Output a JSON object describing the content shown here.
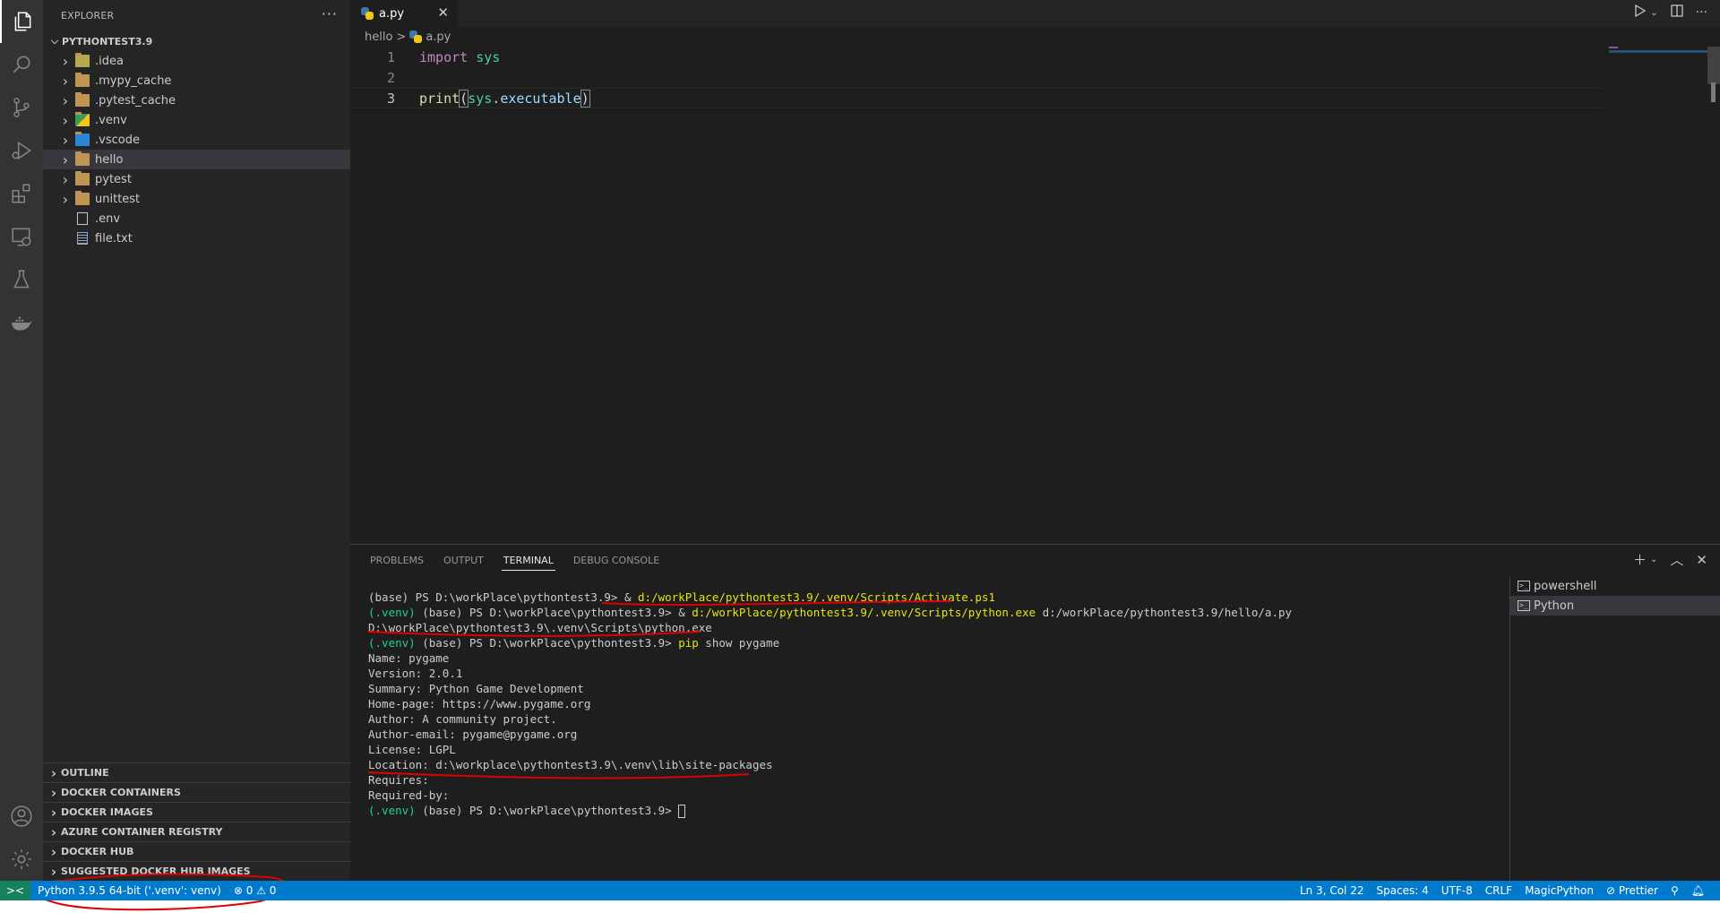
{
  "activity_bar": {
    "items": [
      "explorer",
      "search",
      "source-control",
      "run-and-debug",
      "extensions",
      "remote-explorer",
      "testing",
      "docker"
    ],
    "bottom": [
      "accounts",
      "manage"
    ]
  },
  "sidebar": {
    "title": "EXPLORER",
    "more": "···",
    "root": "PYTHONTEST3.9",
    "items": [
      {
        "label": ".idea",
        "type": "folder-idea"
      },
      {
        "label": ".mypy_cache",
        "type": "folder"
      },
      {
        "label": ".pytest_cache",
        "type": "folder"
      },
      {
        "label": ".venv",
        "type": "folder-python"
      },
      {
        "label": ".vscode",
        "type": "folder-vscode"
      },
      {
        "label": "hello",
        "type": "folder",
        "selected": true
      },
      {
        "label": "pytest",
        "type": "folder"
      },
      {
        "label": "unittest",
        "type": "folder"
      },
      {
        "label": ".env",
        "type": "file"
      },
      {
        "label": "file.txt",
        "type": "text-file"
      }
    ],
    "sections": [
      "OUTLINE",
      "DOCKER CONTAINERS",
      "DOCKER IMAGES",
      "AZURE CONTAINER REGISTRY",
      "DOCKER HUB",
      "SUGGESTED DOCKER HUB IMAGES"
    ]
  },
  "editor": {
    "tab": {
      "label": "a.py",
      "close": "✕"
    },
    "breadcrumb": {
      "folder": "hello",
      "sep": ">",
      "file": "a.py"
    },
    "lines": [
      {
        "n": "1",
        "tokens": [
          [
            "kw",
            "import"
          ],
          [
            "punct",
            " "
          ],
          [
            "mod",
            "sys"
          ]
        ]
      },
      {
        "n": "2",
        "tokens": []
      },
      {
        "n": "3",
        "tokens": [
          [
            "fn",
            "print"
          ],
          [
            "punct-b",
            "("
          ],
          [
            "mod",
            "sys"
          ],
          [
            "punct",
            "."
          ],
          [
            "attr",
            "executable"
          ],
          [
            "punct-b",
            ")"
          ]
        ]
      }
    ],
    "actions": [
      "run-icon",
      "chevron-down-icon",
      "split-editor-icon",
      "more-icon"
    ]
  },
  "panel": {
    "tabs": [
      "PROBLEMS",
      "OUTPUT",
      "TERMINAL",
      "DEBUG CONSOLE"
    ],
    "active_tab": "TERMINAL",
    "terminal_lines": [
      [
        [
          "",
          "(base) PS D:\\workPlace\\pythontest3.9> & "
        ],
        [
          "y",
          "d:/workPlace/pythontest3.9/.venv/Scripts/Activate.ps1"
        ]
      ],
      [
        [
          "g",
          "(.venv) "
        ],
        [
          "",
          "(base) PS D:\\workPlace\\pythontest3.9> & "
        ],
        [
          "y",
          "d:/workPlace/pythontest3.9/.venv/Scripts/python.exe"
        ],
        [
          "",
          " d:/workPlace/pythontest3.9/hello/a.py"
        ]
      ],
      [
        [
          "",
          "D:\\workPlace\\pythontest3.9\\.venv\\Scripts\\python.exe"
        ]
      ],
      [
        [
          "g",
          "(.venv) "
        ],
        [
          "",
          "(base) PS D:\\workPlace\\pythontest3.9> "
        ],
        [
          "y",
          "pip"
        ],
        [
          "",
          " show pygame"
        ]
      ],
      [
        [
          "",
          "Name: pygame"
        ]
      ],
      [
        [
          "",
          "Version: 2.0.1"
        ]
      ],
      [
        [
          "",
          "Summary: Python Game Development"
        ]
      ],
      [
        [
          "",
          "Home-page: https://www.pygame.org"
        ]
      ],
      [
        [
          "",
          "Author: A community project."
        ]
      ],
      [
        [
          "",
          "Author-email: pygame@pygame.org"
        ]
      ],
      [
        [
          "",
          "License: LGPL"
        ]
      ],
      [
        [
          "",
          "Location: d:\\workplace\\pythontest3.9\\.venv\\lib\\site-packages"
        ]
      ],
      [
        [
          "",
          "Requires:"
        ]
      ],
      [
        [
          "",
          "Required-by:"
        ]
      ],
      [
        [
          "g",
          "(.venv) "
        ],
        [
          "",
          "(base) PS D:\\workPlace\\pythontest3.9> "
        ],
        [
          "cursor",
          ""
        ]
      ]
    ],
    "terminals": [
      {
        "label": "powershell",
        "selected": false
      },
      {
        "label": "Python",
        "selected": true
      }
    ]
  },
  "statusbar": {
    "remote": "><",
    "interpreter": "Python 3.9.5 64-bit ('.venv': venv)",
    "errors": "0",
    "warnings": "0",
    "cursor_position": "Ln 3, Col 22",
    "indentation": "Spaces: 4",
    "encoding": "UTF-8",
    "eol": "CRLF",
    "language": "MagicPython",
    "formatter": "Prettier"
  },
  "annotation_color": "#e00000"
}
